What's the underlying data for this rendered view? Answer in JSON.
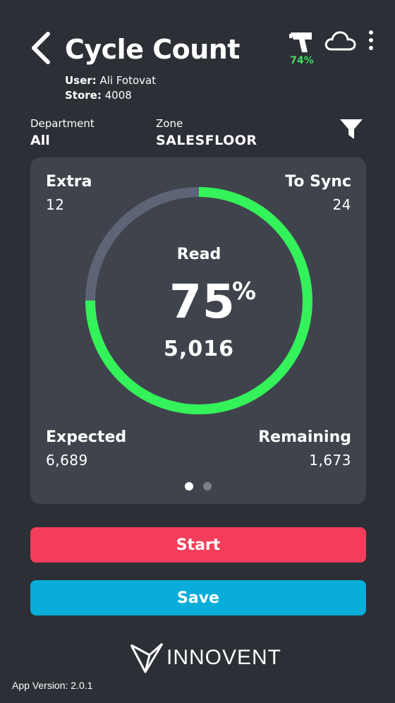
{
  "header": {
    "title": "Cycle Count",
    "user_label": "User:",
    "user_name": "Ali Fotovat",
    "store_label": "Store:",
    "store_number": "4008",
    "battery_level": "74%",
    "icons": [
      "back-chevron-icon",
      "scanner-gun-icon",
      "cloud-icon",
      "more-vertical-icon"
    ]
  },
  "filters": {
    "department_label": "Department",
    "department_value": "All",
    "zone_label": "Zone",
    "zone_value": "SALESFLOOR",
    "filter_icon": "funnel-icon"
  },
  "summary": {
    "extra_label": "Extra",
    "extra_value": "12",
    "to_sync_label": "To Sync",
    "to_sync_value": "24",
    "read_label": "Read",
    "read_percent": "75",
    "percent_sign": "%",
    "read_count": "5,016",
    "expected_label": "Expected",
    "expected_value": "6,689",
    "remaining_label": "Remaining",
    "remaining_value": "1,673",
    "progress_fraction": 0.75,
    "page_count": 2,
    "active_page": 1
  },
  "actions": {
    "start_label": "Start",
    "save_label": "Save"
  },
  "footer": {
    "brand": "INNOVENT",
    "version_text": "App Version: 2.0.1"
  },
  "colors": {
    "background": "#2c2f35",
    "card": "#3f444c",
    "progress": "#33f25a",
    "track": "#5d6476",
    "battery": "#3ddc5f",
    "start_button": "#f43d5a",
    "save_button": "#08add9"
  }
}
